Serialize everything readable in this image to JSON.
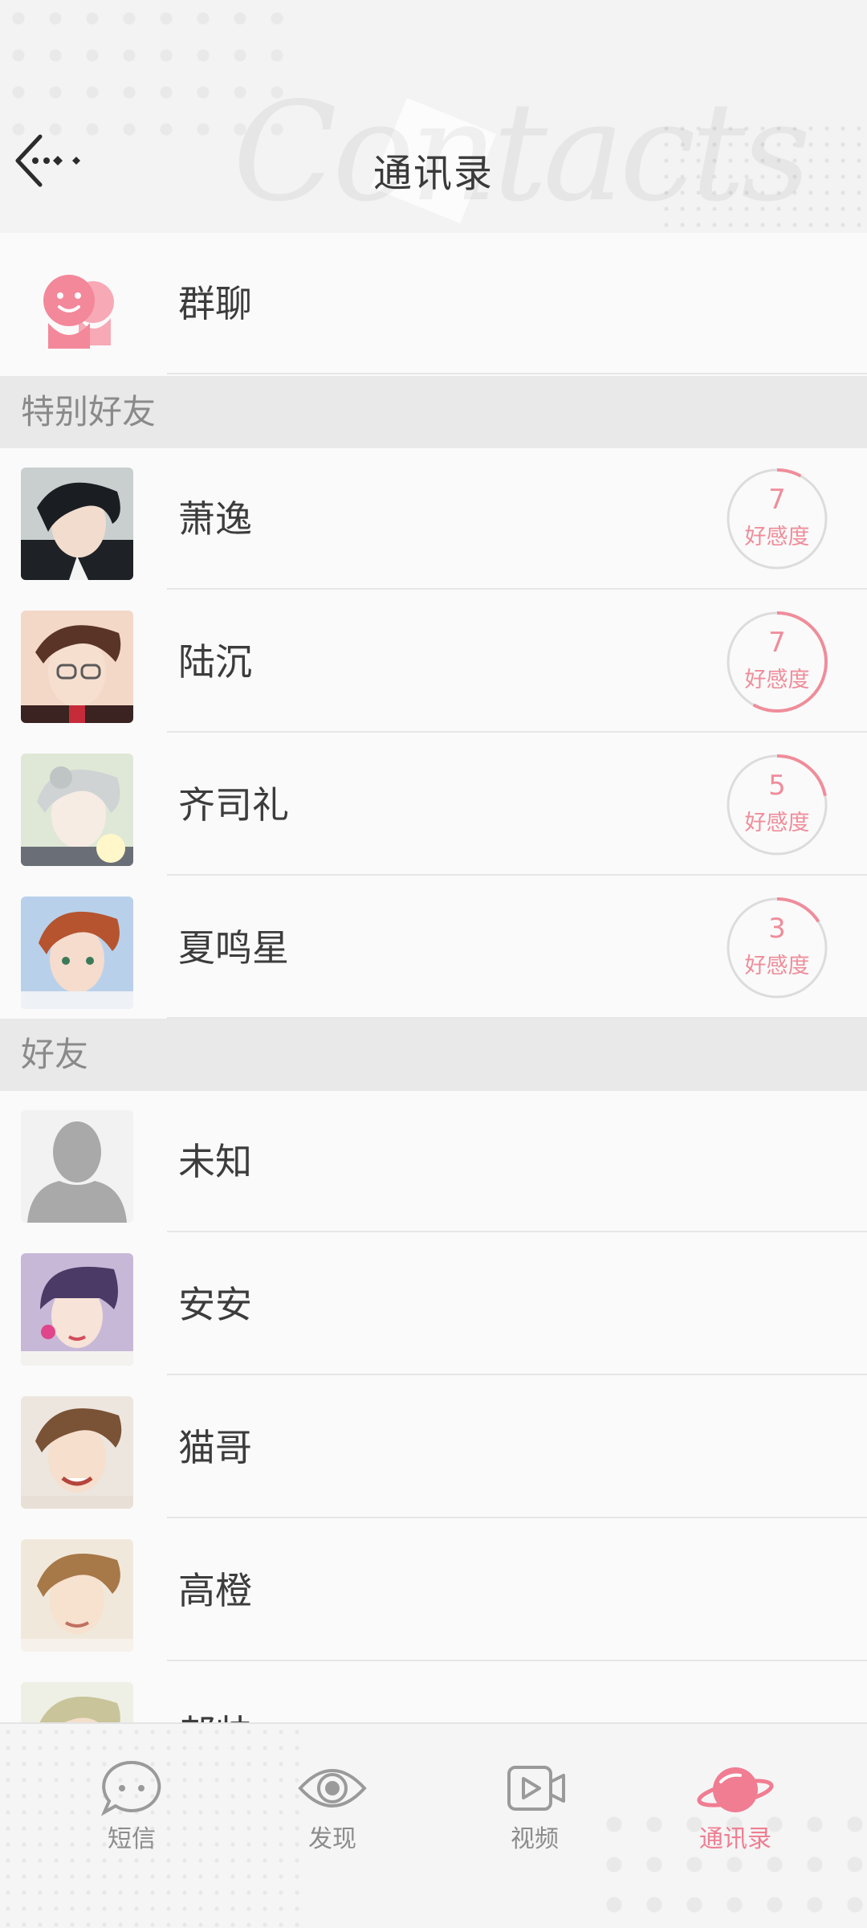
{
  "header": {
    "title": "通讯录",
    "back_icon": "back-arrow-icon",
    "background_script": "Contacts"
  },
  "group_chat": {
    "label": "群聊",
    "icon": "group-chat-icon",
    "icon_color": "#f3889a"
  },
  "sections": {
    "special": "特别好友",
    "friends": "好友"
  },
  "special_friends": [
    {
      "name": "萧逸",
      "affection": "7",
      "affection_label": "好感度",
      "affection_fraction": 0.08
    },
    {
      "name": "陆沉",
      "affection": "7",
      "affection_label": "好感度",
      "affection_fraction": 0.58
    },
    {
      "name": "齐司礼",
      "affection": "5",
      "affection_label": "好感度",
      "affection_fraction": 0.22
    },
    {
      "name": "夏鸣星",
      "affection": "3",
      "affection_label": "好感度",
      "affection_fraction": 0.16
    }
  ],
  "friends": [
    {
      "name": "未知"
    },
    {
      "name": "安安"
    },
    {
      "name": "猫哥"
    },
    {
      "name": "高橙"
    },
    {
      "name": "郝帅"
    }
  ],
  "bottom_nav": [
    {
      "label": "短信",
      "icon": "message-bubble-icon"
    },
    {
      "label": "发现",
      "icon": "eye-icon"
    },
    {
      "label": "视频",
      "icon": "video-play-icon"
    },
    {
      "label": "通讯录",
      "icon": "planet-icon",
      "active": true
    }
  ],
  "colors": {
    "accent": "#ef7e92",
    "section_bg": "#e9e9e9",
    "row_bg": "#fafafa"
  }
}
